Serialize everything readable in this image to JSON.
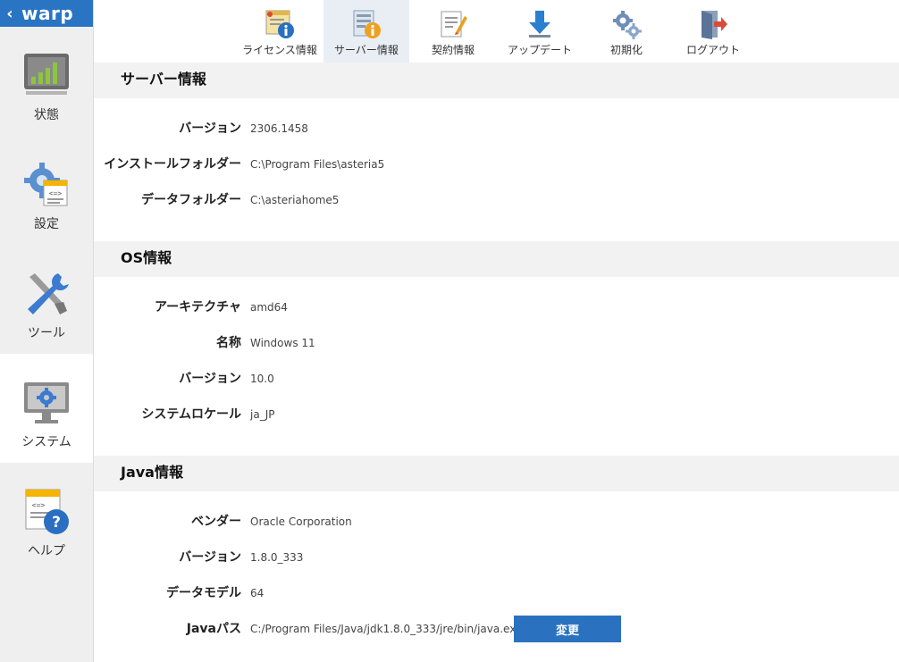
{
  "brand": {
    "back_icon": "chevron-left-icon",
    "name": "warp",
    "color": "#2a74c4"
  },
  "sidebar": {
    "items": [
      {
        "label": "状態",
        "icon": "status-chart-icon"
      },
      {
        "label": "設定",
        "icon": "settings-gear-icon"
      },
      {
        "label": "ツール",
        "icon": "tools-icon"
      },
      {
        "label": "システム",
        "icon": "system-monitor-icon",
        "active": true
      },
      {
        "label": "ヘルプ",
        "icon": "help-icon"
      }
    ]
  },
  "toolbar": {
    "items": [
      {
        "label": "ライセンス情報",
        "icon": "license-info-icon"
      },
      {
        "label": "サーバー情報",
        "icon": "server-info-icon",
        "active": true
      },
      {
        "label": "契約情報",
        "icon": "contract-icon"
      },
      {
        "label": "アップデート",
        "icon": "download-icon"
      },
      {
        "label": "初期化",
        "icon": "gears-icon"
      },
      {
        "label": "ログアウト",
        "icon": "logout-icon"
      }
    ]
  },
  "sections": {
    "server": {
      "title": "サーバー情報",
      "rows": [
        {
          "label": "バージョン",
          "value": "2306.1458"
        },
        {
          "label": "インストールフォルダー",
          "value": "C:\\Program Files\\asteria5"
        },
        {
          "label": "データフォルダー",
          "value": "C:\\asteriahome5"
        }
      ]
    },
    "os": {
      "title": "OS情報",
      "rows": [
        {
          "label": "アーキテクチャ",
          "value": "amd64"
        },
        {
          "label": "名称",
          "value": "Windows 11"
        },
        {
          "label": "バージョン",
          "value": "10.0"
        },
        {
          "label": "システムロケール",
          "value": "ja_JP"
        }
      ]
    },
    "java": {
      "title": "Java情報",
      "rows": [
        {
          "label": "ベンダー",
          "value": "Oracle Corporation"
        },
        {
          "label": "バージョン",
          "value": "1.8.0_333"
        },
        {
          "label": "データモデル",
          "value": "64"
        },
        {
          "label": "Javaパス",
          "value": "C:/Program Files/Java/jdk1.8.0_333/jre/bin/java.exe"
        }
      ],
      "change_button": "変更"
    }
  },
  "colors": {
    "accent": "#2a74c4",
    "button": "#2a72c0",
    "section_bg": "#f2f2f2",
    "sidebar_bg": "#efefef",
    "active_tab_bg": "#e9eef4"
  }
}
